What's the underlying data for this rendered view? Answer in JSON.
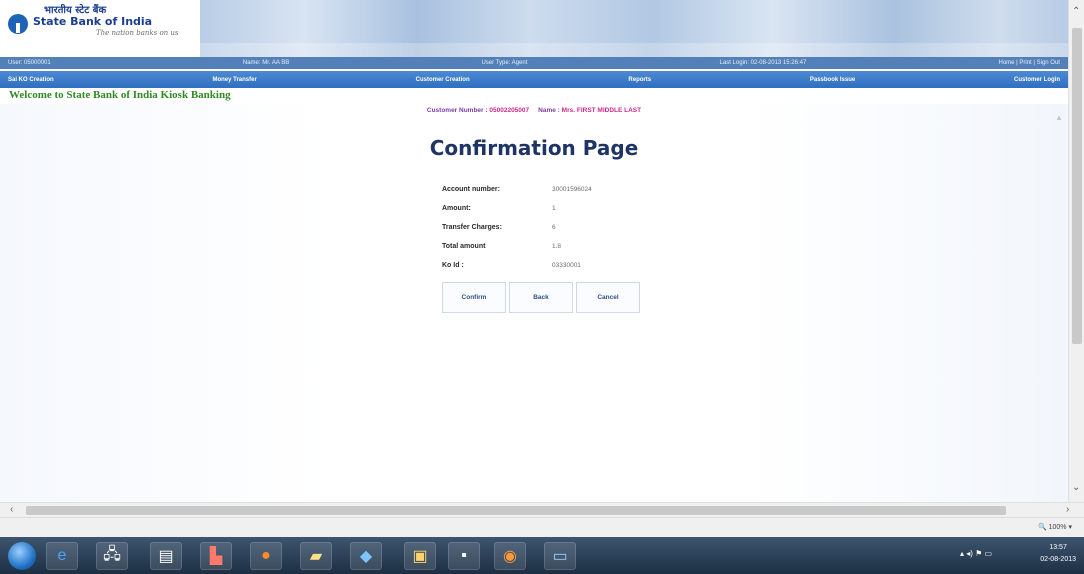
{
  "header": {
    "logo_hindi": "भारतीय स्टेट बैंक",
    "logo_name": "State Bank of India",
    "logo_tagline": "The nation banks on us"
  },
  "infobar": {
    "user": "User: 05000001",
    "name": "Name: Mr. AA BB",
    "user_type": "User Type: Agent",
    "last_login": "Last Login: 02-08-2013 15:26:47",
    "links": "Home | Print | Sign Out"
  },
  "menu": {
    "items": [
      "Sai KO Creation",
      "Money Transfer",
      "Customer Creation",
      "Reports",
      "Passbook Issue",
      "Customer Login"
    ]
  },
  "welcome": "Welcome to State Bank of India Kiosk Banking",
  "customer": {
    "number_label": "Customer Number :",
    "number_value": "05002205007",
    "name_label": "Name :",
    "name_value": "Mrs. FIRST MIDDLE LAST"
  },
  "page_title": "Confirmation Page",
  "details": [
    {
      "label": "Account number:",
      "value": "30001596024"
    },
    {
      "label": "Amount:",
      "value": "1"
    },
    {
      "label": "Transfer Charges:",
      "value": "6"
    },
    {
      "label": "Total amount",
      "value": "1.8"
    },
    {
      "label": "Ko Id :",
      "value": "03330001"
    }
  ],
  "buttons": {
    "confirm": "Confirm",
    "back": "Back",
    "cancel": "Cancel"
  },
  "statusbar": {
    "zoom": "100%"
  },
  "taskbar": {
    "time": "13:57",
    "date": "02-08-2013"
  }
}
